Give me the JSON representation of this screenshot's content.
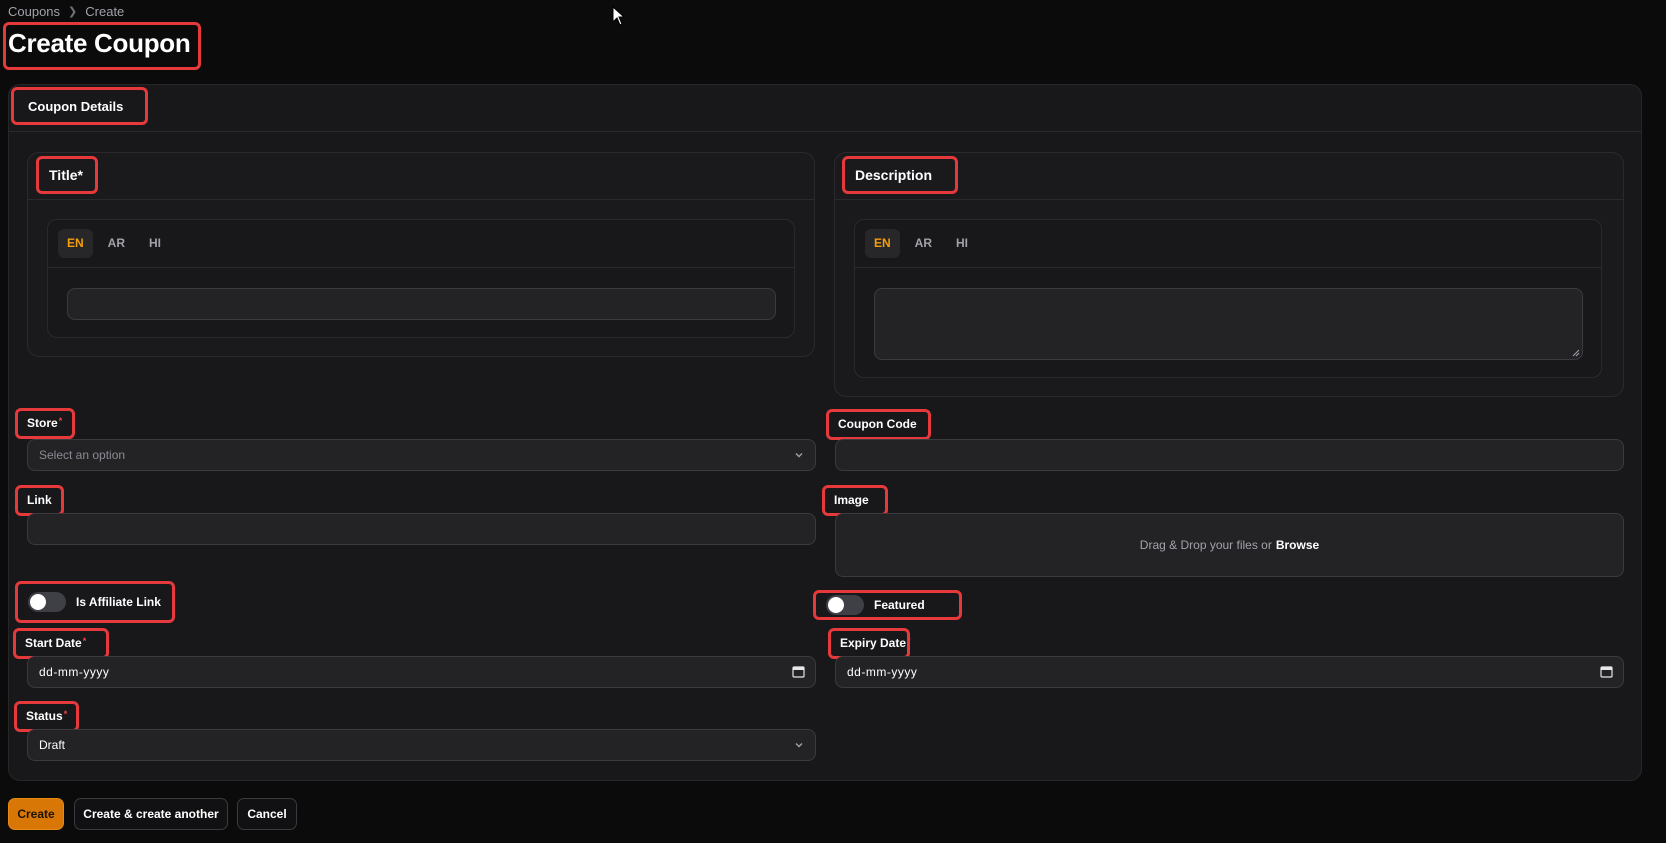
{
  "breadcrumb": {
    "items": [
      "Coupons",
      "Create"
    ]
  },
  "page": {
    "title": "Create Coupon"
  },
  "section": {
    "title": "Coupon Details"
  },
  "title_field": {
    "label": "Title*",
    "tabs": [
      "EN",
      "AR",
      "HI"
    ],
    "active_tab": "EN",
    "value": ""
  },
  "description_field": {
    "label": "Description",
    "tabs": [
      "EN",
      "AR",
      "HI"
    ],
    "active_tab": "EN",
    "value": ""
  },
  "store": {
    "label": "Store",
    "required_mark": "*",
    "placeholder": "Select an option"
  },
  "coupon_code": {
    "label": "Coupon Code",
    "value": ""
  },
  "link": {
    "label": "Link",
    "value": ""
  },
  "image": {
    "label": "Image",
    "drop_text": "Drag & Drop your files or",
    "browse_text": "Browse"
  },
  "affiliate": {
    "label": "Is Affiliate Link",
    "checked": false
  },
  "featured": {
    "label": "Featured",
    "checked": false
  },
  "start_date": {
    "label": "Start Date",
    "required_mark": "*",
    "placeholder": "dd-mm-yyyy"
  },
  "expiry_date": {
    "label": "Expiry Date",
    "required_mark": "*",
    "placeholder": "dd-mm-yyyy"
  },
  "status": {
    "label": "Status",
    "required_mark": "*",
    "value": "Draft"
  },
  "actions": {
    "create": "Create",
    "create_another": "Create & create another",
    "cancel": "Cancel"
  },
  "colors": {
    "accent": "#d97706",
    "tab_active": "#f59e0b",
    "highlight": "#e5393b",
    "background": "#0b0b0c",
    "card": "#18181b"
  }
}
